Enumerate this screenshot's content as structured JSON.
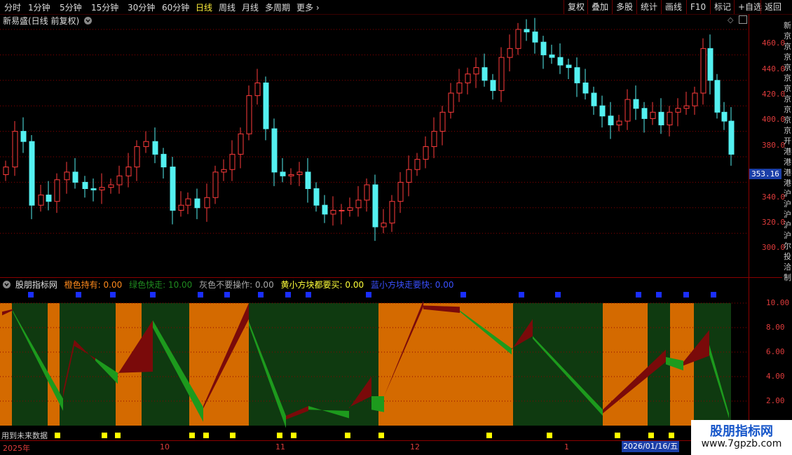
{
  "toolbar": {
    "periods": [
      "分时",
      "1分钟",
      "5分钟",
      "15分钟",
      "30分钟",
      "60分钟",
      "日线",
      "周线",
      "月线",
      "多周期",
      "更多"
    ],
    "active_period": "日线",
    "right_buttons": [
      "复权",
      "叠加",
      "多股",
      "统计",
      "画线",
      "F10",
      "标记",
      "+自选",
      "返回"
    ]
  },
  "main_chart": {
    "title": "新易盛(日线 前复权)",
    "price_axis": [
      "460.0",
      "440.0",
      "420.0",
      "400.0",
      "380.0",
      "360.0",
      "340.0",
      "320.0",
      "300.0"
    ],
    "last_price": "353.16",
    "colors": {
      "up": "#ff3b3b",
      "down": "#54f1f1",
      "grid": "#8b0000"
    }
  },
  "indicator": {
    "name": "股朋指标网",
    "items": [
      {
        "label": "橙色持有: 0.00",
        "color": "#ff8a1c"
      },
      {
        "label": "绿色快走: 10.00",
        "color": "#1f8a1f"
      },
      {
        "label": "灰色不要操作: 0.00",
        "color": "#a8a8a8"
      },
      {
        "label": "黄小方块都要买: 0.00",
        "color": "#ffff3a"
      },
      {
        "label": "蓝小方块走要快: 0.00",
        "color": "#3a50ff"
      }
    ],
    "axis": [
      "10.00",
      "8.00",
      "6.00",
      "4.00",
      "2.00"
    ],
    "future_label": "用到未来数据",
    "colors": {
      "orange": "#d46a00",
      "dark_green": "#0f3a10",
      "green": "#1d9a1d",
      "red": "#7a0a0a",
      "yellow": "#ffff00",
      "blue": "#1a2eff"
    }
  },
  "x_axis": {
    "labels": [
      "2025年",
      "10",
      "11",
      "12",
      "1"
    ],
    "current_date": "2026/01/16/五"
  },
  "watermark": {
    "title": "股朋指标网",
    "url": "www.7gpzb.com"
  },
  "right_strip": {
    "chars": [
      "新",
      "京",
      "京",
      "京",
      "京",
      "京",
      "京",
      "京",
      "京",
      "京",
      "京",
      "开",
      "港",
      "港",
      "港",
      "港",
      "沪",
      "沪",
      "沪",
      "沪",
      "沪",
      "尔",
      "投",
      "洽",
      "制"
    ]
  }
}
